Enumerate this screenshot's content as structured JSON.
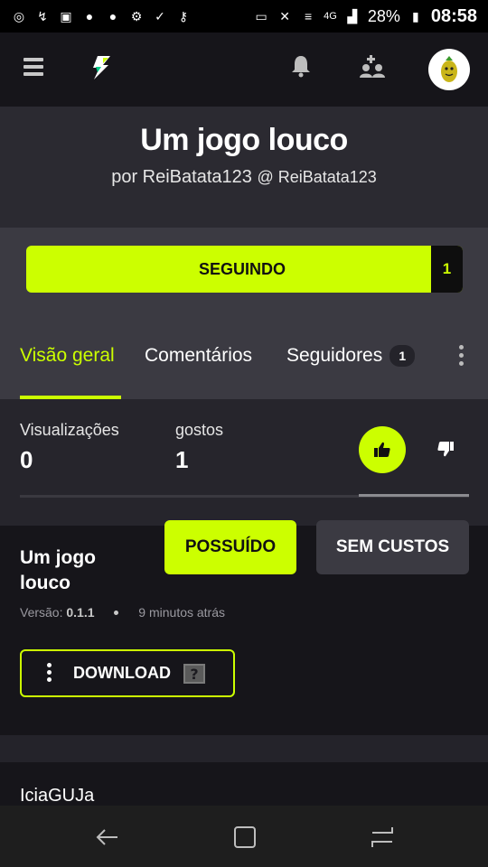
{
  "status_bar": {
    "battery": "28%",
    "time": "08:58",
    "network": "4G"
  },
  "app_bar": {
    "menu_icon": "hamburger-icon",
    "logo_icon": "lightning-logo-icon",
    "notifications_icon": "bell-icon",
    "friends_icon": "add-user-icon",
    "avatar_icon": "avatar-icon"
  },
  "hero": {
    "title": "Um jogo louco",
    "by": "por ReiBatata123",
    "handle": "@ ReiBatata123"
  },
  "follow": {
    "label": "SEGUINDO",
    "count": "1"
  },
  "tabs": [
    {
      "label": "Visão geral",
      "active": true
    },
    {
      "label": "Comentários",
      "active": false
    },
    {
      "label": "Seguidores",
      "badge": "1",
      "active": false
    }
  ],
  "stats": {
    "views_label": "Visualizações",
    "views_value": "0",
    "likes_label": "gostos",
    "likes_value": "1"
  },
  "release": {
    "title": "Um jogo louco",
    "owned_label": "POSSUÍDO",
    "price_label": "SEM CUSTOS",
    "version_prefix": "Versão:",
    "version_value": "0.1.1",
    "time_ago": "9 minutos atrás",
    "download_label": "DOWNLOAD"
  },
  "author_section": {
    "name": "IciaGUJa"
  },
  "colors": {
    "accent": "#ccff00",
    "background": "#1c1b20"
  }
}
